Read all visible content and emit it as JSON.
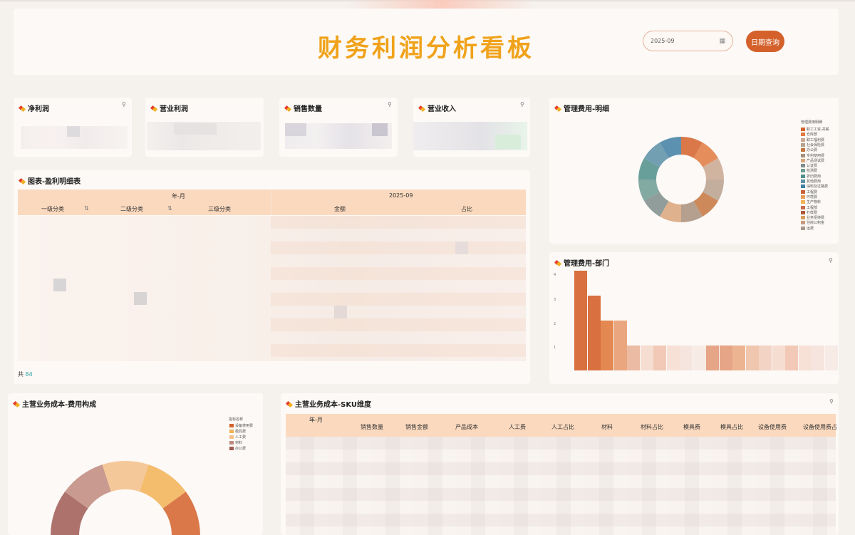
{
  "header": {
    "title": "财务利润分析看板",
    "date_value": "2025-09",
    "query_button": "日期查询"
  },
  "kpi_cards": [
    {
      "title": "净利润"
    },
    {
      "title": "营业利润"
    },
    {
      "title": "销售数量"
    },
    {
      "title": "营业收入"
    }
  ],
  "profit_table": {
    "title": "图表-盈利明细表",
    "group_header": "年-月",
    "period": "2025-09",
    "columns": [
      "一级分类",
      "二级分类",
      "三级分类",
      "金额",
      "占比"
    ],
    "total_prefix": "共",
    "total_count": "84"
  },
  "mgmt_detail": {
    "title": "管理费用-明细",
    "legend_title": "管理费用明细",
    "legend_items": [
      "职工工资-共薪",
      "仓库部",
      "职工福利费",
      "社会保险费",
      "办公费",
      "专利使用费",
      "产品测试费",
      "认证费",
      "检测费",
      "折旧费用",
      "其他费用",
      "油料及过路费",
      "工程费",
      "环境费",
      "生产物料",
      "工程部",
      "打样费",
      "业务招待费",
      "住房公积金",
      "运费"
    ],
    "legend_colors": [
      "#d4612b",
      "#e07b3f",
      "#c9a890",
      "#b8a08d",
      "#c4753d",
      "#a88f7b",
      "#d9a47a",
      "#7e8d8a",
      "#6c9c94",
      "#4f8f8b",
      "#5b8fa6",
      "#3f7fa3",
      "#c95f35",
      "#e89c5a",
      "#f2b155",
      "#c96b4a",
      "#b0573c",
      "#d69d5e",
      "#c79a80",
      "#a8968a"
    ]
  },
  "mgmt_dept": {
    "title": "管理费用-部门",
    "y_ticks": [
      "4",
      "3",
      "2",
      "1"
    ]
  },
  "cost_composition": {
    "title": "主营业务成本-费用构成",
    "legend_title": "指标名称",
    "legend_items": [
      "设备使用费",
      "模具费",
      "人工费",
      "材料",
      "办公费"
    ],
    "legend_colors": [
      "#d4612b",
      "#f2b155",
      "#f3c08a",
      "#c0897e",
      "#a05a55"
    ]
  },
  "sku_table": {
    "title": "主营业务成本-SKU维度",
    "columns": [
      "年-月",
      "销售数量",
      "销售金额",
      "产品成本",
      "人工费",
      "人工占比",
      "材料",
      "材料占比",
      "模具费",
      "模具占比",
      "设备使用费",
      "设备使用费占"
    ]
  }
}
